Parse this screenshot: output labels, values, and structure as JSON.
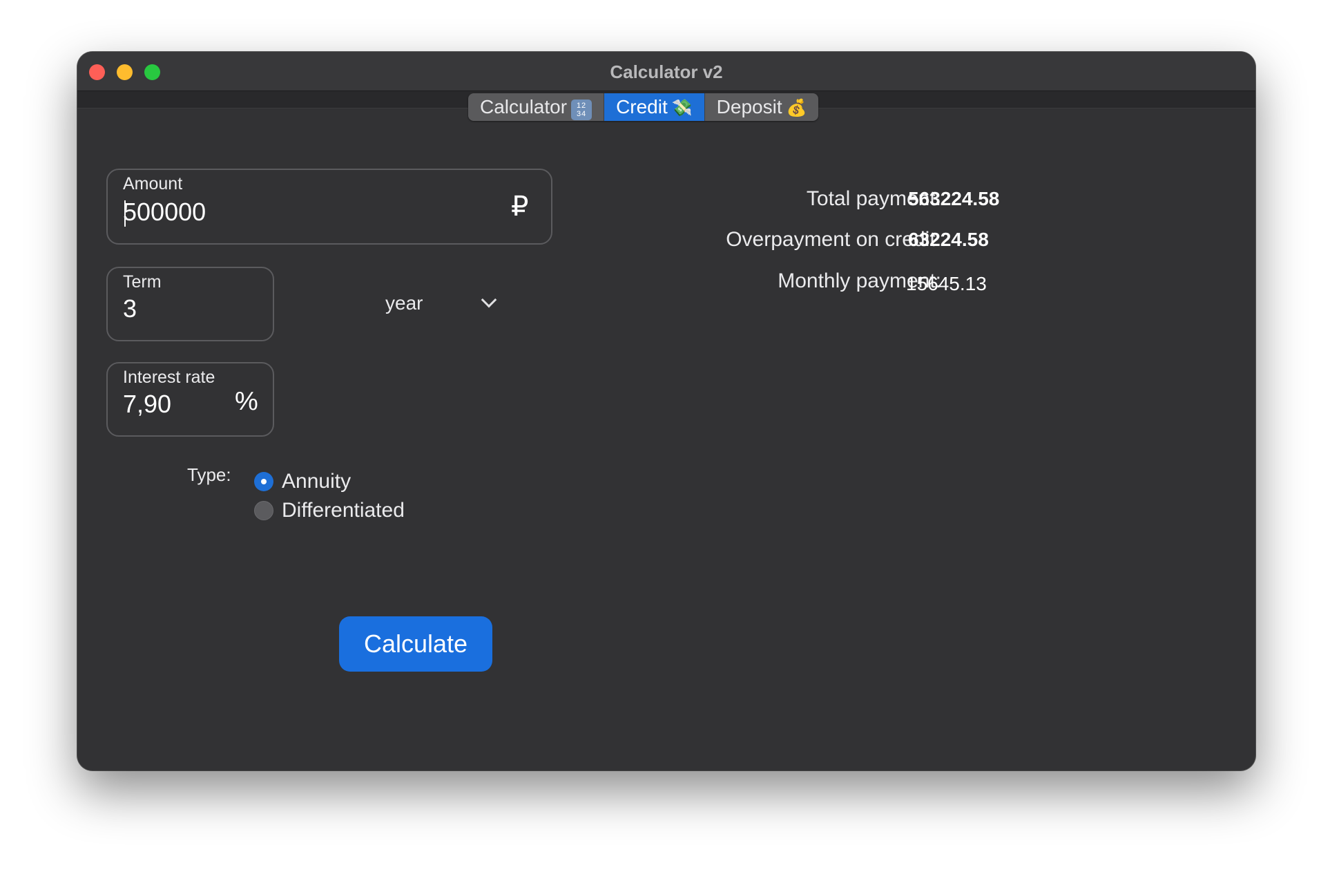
{
  "window": {
    "title": "Calculator v2"
  },
  "tabs": [
    {
      "label": "Calculator",
      "icon": "input-numbers-icon"
    },
    {
      "label": "Credit",
      "icon": "money-with-wings-icon"
    },
    {
      "label": "Deposit",
      "icon": "money-bag-icon"
    }
  ],
  "active_tab": "Credit",
  "form": {
    "amount": {
      "label": "Amount",
      "value": "500000",
      "suffix": "₽"
    },
    "term": {
      "label": "Term",
      "value": "3",
      "unit_selected": "year"
    },
    "interest": {
      "label": "Interest rate",
      "value": "7,90",
      "suffix": "%"
    },
    "type": {
      "label": "Type:",
      "options": [
        {
          "label": "Annuity",
          "selected": true
        },
        {
          "label": "Differentiated",
          "selected": false
        }
      ]
    },
    "calculate_label": "Calculate"
  },
  "results": {
    "total_label": "Total payment:",
    "total_value": "563224.58",
    "overpayment_label": "Overpayment on credit:",
    "overpayment_value": "63224.58",
    "monthly_label": "Monthly payment:",
    "monthly_value": "15645.13"
  },
  "colors": {
    "accent": "#1e6fd6",
    "background": "#323234"
  }
}
